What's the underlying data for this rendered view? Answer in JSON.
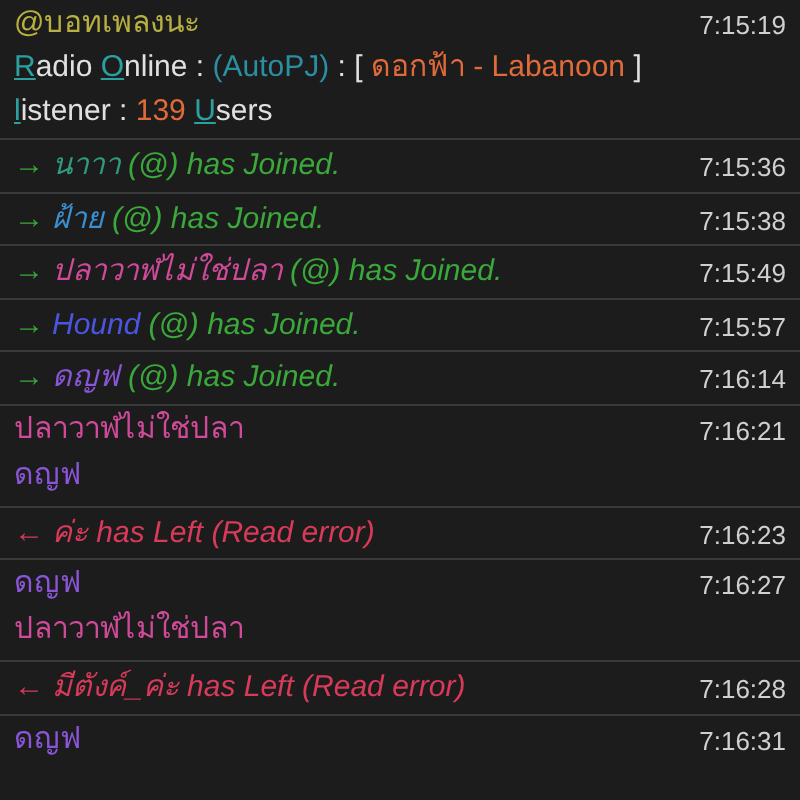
{
  "messages": [
    {
      "kind": "bot",
      "sender": {
        "name": "@บอทเพลงนะ",
        "color": "#b8b040"
      },
      "time": "7:15:19",
      "lines": [
        [
          {
            "text": "R",
            "color": "#2aa0a0",
            "underline": true
          },
          {
            "text": "adio ",
            "color": "#e0e0e0",
            "underline": false
          },
          {
            "text": "O",
            "color": "#2aa0a0",
            "underline": true
          },
          {
            "text": "nline : ",
            "color": "#e0e0e0",
            "underline": false
          },
          {
            "text": "(AutoPJ)",
            "color": "#2a8fa0",
            "underline": false
          },
          {
            "text": " : [ ",
            "color": "#e0e0e0",
            "underline": false
          },
          {
            "text": "ดอกฟ้า - Labanoon",
            "color": "#e06a3a",
            "underline": false
          },
          {
            "text": " ]",
            "color": "#e0e0e0",
            "underline": false
          }
        ],
        [
          {
            "text": "l",
            "color": "#2aa0a0",
            "underline": true
          },
          {
            "text": "istener : ",
            "color": "#e0e0e0",
            "underline": false
          },
          {
            "text": "139 ",
            "color": "#e06a3a",
            "underline": false
          },
          {
            "text": "U",
            "color": "#2aa0a0",
            "underline": true
          },
          {
            "text": "sers",
            "color": "#e0e0e0",
            "underline": false
          }
        ]
      ]
    },
    {
      "kind": "join",
      "arrow": "→",
      "name": "นาาา",
      "color": "#2f9a7f",
      "text": "(@) has Joined.",
      "time": "7:15:36"
    },
    {
      "kind": "join",
      "arrow": "→",
      "name": "ฝ้าย",
      "color": "#3a8fd0",
      "text": "(@) has Joined.",
      "time": "7:15:38"
    },
    {
      "kind": "join",
      "arrow": "→",
      "name": "ปลาวาฬไม่ใช่ปลา",
      "color": "#d04a9a",
      "text": "(@) has Joined.",
      "time": "7:15:49"
    },
    {
      "kind": "join",
      "arrow": "→",
      "name": "Hound",
      "color": "#4a55e0",
      "text": "(@) has Joined.",
      "time": "7:15:57"
    },
    {
      "kind": "join",
      "arrow": "→",
      "name": "ดญฟ",
      "color": "#8a55d8",
      "text": "(@) has Joined.",
      "time": "7:16:14"
    },
    {
      "kind": "chat",
      "sender": {
        "name": "ปลาวาฬไม่ใช่ปลา",
        "color": "#d04a9a"
      },
      "message": {
        "text": "ดญฟ",
        "color": "#8a55d8"
      },
      "time": "7:16:21"
    },
    {
      "kind": "leave",
      "arrow": "←",
      "text": "ค่ะ has Left (Read error)",
      "time": "7:16:23"
    },
    {
      "kind": "chat",
      "sender": {
        "name": "ดญฟ",
        "color": "#8a55d8"
      },
      "message": {
        "text": "ปลาวาฬไม่ใช่ปลา",
        "color": "#d04a9a"
      },
      "time": "7:16:27"
    },
    {
      "kind": "leave",
      "arrow": "←",
      "text": "มีตังค์_ค่ะ has Left (Read error)",
      "time": "7:16:28"
    },
    {
      "kind": "chat",
      "sender": {
        "name": "ดญฟ",
        "color": "#8a55d8"
      },
      "time": "7:16:31"
    }
  ]
}
